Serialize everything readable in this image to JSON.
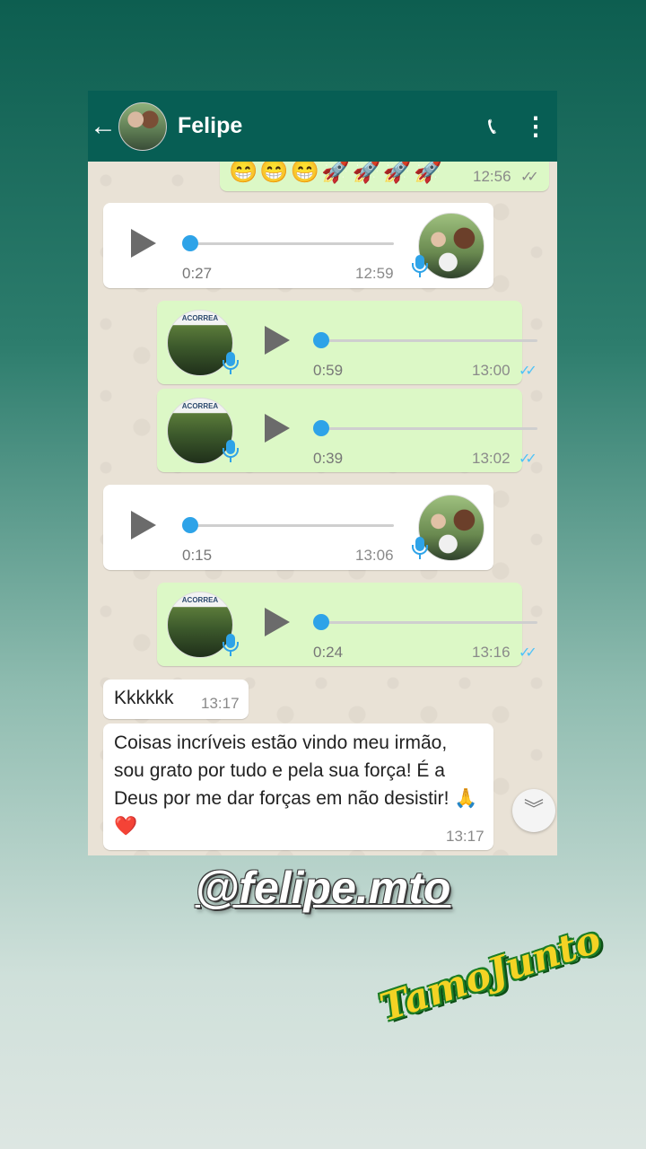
{
  "header": {
    "back_icon": "arrow-left-icon",
    "contact_name": "Felipe",
    "call_icon": "add-call-icon",
    "menu_icon": "more-vert-icon"
  },
  "messages": [
    {
      "type": "emoji_out",
      "emojis": "😁😁😁🚀🚀🚀🚀",
      "time": "12:56",
      "read": false
    },
    {
      "type": "voice_in",
      "duration": "0:27",
      "time": "12:59"
    },
    {
      "type": "voice_out",
      "duration": "0:59",
      "time": "13:00",
      "read": true,
      "avatar_text": "ACORREA"
    },
    {
      "type": "voice_out",
      "duration": "0:39",
      "time": "13:02",
      "read": true,
      "avatar_text": "ACORREA"
    },
    {
      "type": "voice_in",
      "duration": "0:15",
      "time": "13:06"
    },
    {
      "type": "voice_out",
      "duration": "0:24",
      "time": "13:16",
      "read": true,
      "avatar_text": "ACORREA"
    },
    {
      "type": "text_in",
      "text": "Kkkkkk",
      "time": "13:17"
    },
    {
      "type": "text_in",
      "text": "Coisas incríveis estão vindo meu irmão, sou grato por tudo e pela sua força! É a Deus por me dar forças em não desistir! 🙏❤️",
      "time": "13:17"
    }
  ],
  "tick_glyph": "✓✓",
  "scroll_down_glyph": "︾",
  "overlay": {
    "handle": "@felipe.mto",
    "sticker": "TamoJunto"
  },
  "colors": {
    "header": "#075e54",
    "bubble_out": "#dcf8c6",
    "bubble_in": "#ffffff",
    "read_ticks": "#4fc3f7",
    "voice_knob": "#2ea3e8"
  }
}
